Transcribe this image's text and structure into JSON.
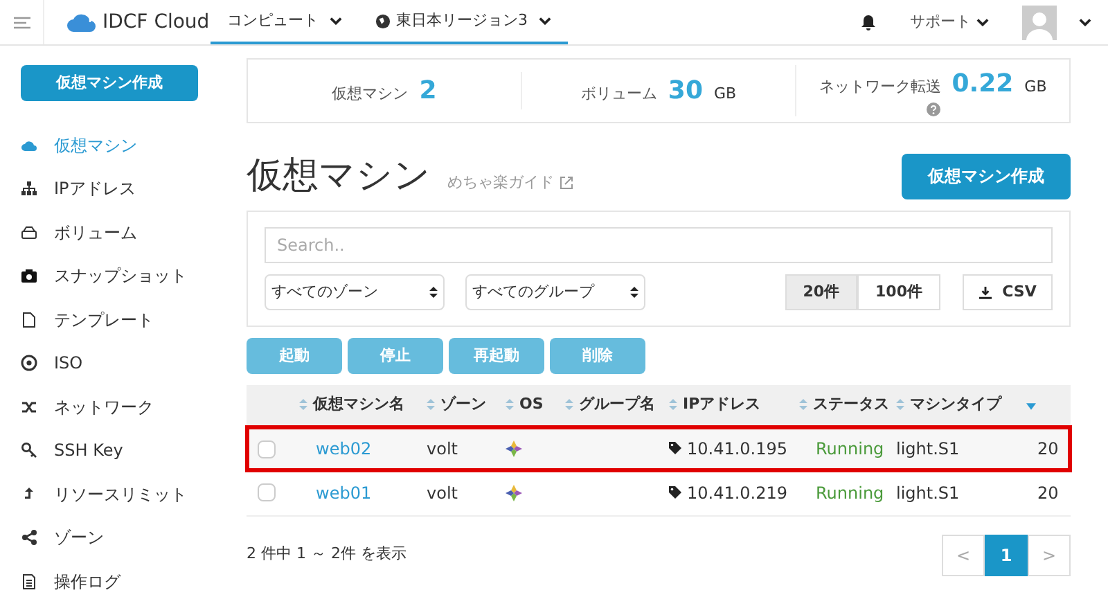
{
  "header": {
    "logo": "IDCF Cloud",
    "menus": [
      {
        "label": "コンピュート",
        "selected": true,
        "kind": "plain"
      },
      {
        "label": "東日本リージョン3",
        "selected": true,
        "kind": "region"
      }
    ],
    "support": "サポート"
  },
  "sidebar": {
    "create_button": "仮想マシン作成",
    "items": [
      {
        "label": "仮想マシン",
        "selected": true
      },
      {
        "label": "IPアドレス",
        "selected": false
      },
      {
        "label": "ボリューム",
        "selected": false
      },
      {
        "label": "スナップショット",
        "selected": false
      },
      {
        "label": "テンプレート",
        "selected": false
      },
      {
        "label": "ISO",
        "selected": false
      },
      {
        "label": "ネットワーク",
        "selected": false
      },
      {
        "label": "SSH Key",
        "selected": false
      },
      {
        "label": "リソースリミット",
        "selected": false
      },
      {
        "label": "ゾーン",
        "selected": false
      },
      {
        "label": "操作ログ",
        "selected": false
      }
    ]
  },
  "stats": [
    {
      "label": "仮想マシン",
      "value": "2"
    },
    {
      "label": "ボリューム",
      "value": "30",
      "unit": "GB"
    },
    {
      "label": "ネットワーク転送",
      "value": "0.22",
      "unit": "GB",
      "help": true
    }
  ],
  "page_title": "仮想マシン",
  "guide_link": "めちゃ楽ガイド",
  "create_button": "仮想マシン作成",
  "filters": {
    "search_placeholder": "Search..",
    "zone_select": "すべてのゾーン",
    "group_select": "すべてのグループ",
    "page_sizes": [
      {
        "label": "20件",
        "selected": true
      },
      {
        "label": "100件",
        "selected": false
      }
    ],
    "csv_button": "CSV"
  },
  "actions": [
    "起動",
    "停止",
    "再起動",
    "削除"
  ],
  "table": {
    "columns": [
      {
        "label": "仮想マシン名",
        "sorted": false
      },
      {
        "label": "ゾーン",
        "sorted": false
      },
      {
        "label": "OS",
        "sorted": false
      },
      {
        "label": "グループ名",
        "sorted": false
      },
      {
        "label": "IPアドレス",
        "sorted": false
      },
      {
        "label": "ステータス",
        "sorted": false
      },
      {
        "label": "マシンタイプ",
        "sorted": false
      },
      {
        "sorted": true
      }
    ],
    "rows": [
      {
        "checked": false,
        "highlighted": true,
        "name": "web02",
        "zone": "volt",
        "ip": "10.41.0.195",
        "status": "Running",
        "type": "light.S1",
        "column_8": "20"
      },
      {
        "checked": false,
        "highlighted": false,
        "name": "web01",
        "zone": "volt",
        "ip": "10.41.0.219",
        "status": "Running",
        "type": "light.S1",
        "column_8": "20"
      }
    ]
  },
  "summary": "2 件中 1 ～ 2件 を表示",
  "pagination": {
    "prev": "<",
    "pages": [
      {
        "label": "1",
        "selected": true
      }
    ],
    "next": ">"
  }
}
